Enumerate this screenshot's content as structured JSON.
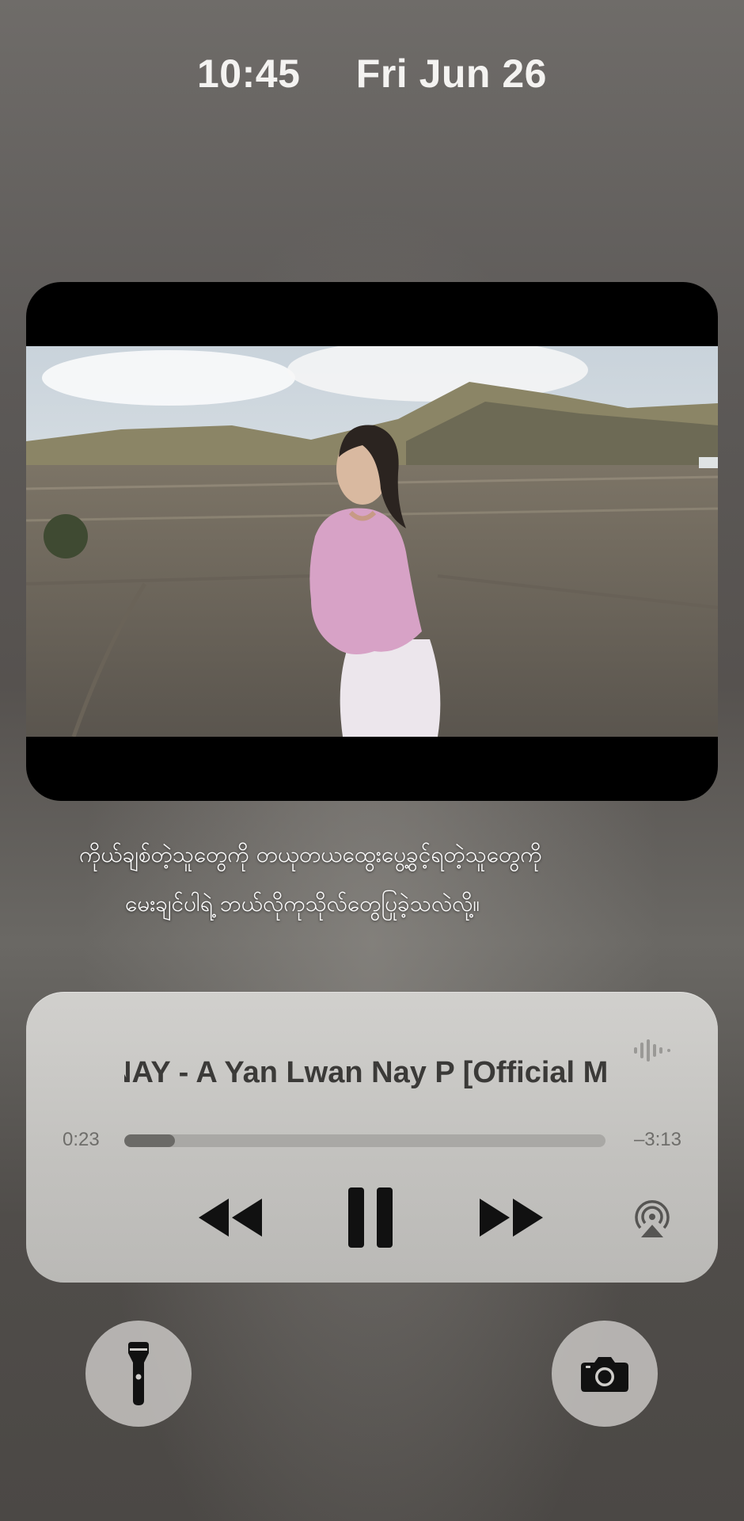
{
  "status": {
    "time": "10:45",
    "date": "Fri Jun 26"
  },
  "subtitles": {
    "line1": "ကိုယ်ချစ်တဲ့သူတွေကို တယုတယထွေးပွေ့ခွင့်ရတဲ့သူတွေကို",
    "line2": "မေးချင်ပါရဲ့ ဘယ်လိုကုသိုလ်တွေပြုခဲ့သလဲလို့။"
  },
  "now_playing": {
    "title": "NAY - A Yan Lwan Nay P [Official M",
    "elapsed": "0:23",
    "remaining": "–3:13",
    "progress": 0.105
  },
  "icons": {
    "wave": "audio-wave-icon",
    "rewind": "rewind-icon",
    "pause": "pause-icon",
    "forward": "fast-forward-icon",
    "airplay": "airplay-icon",
    "flashlight": "flashlight-icon",
    "camera": "camera-icon"
  }
}
